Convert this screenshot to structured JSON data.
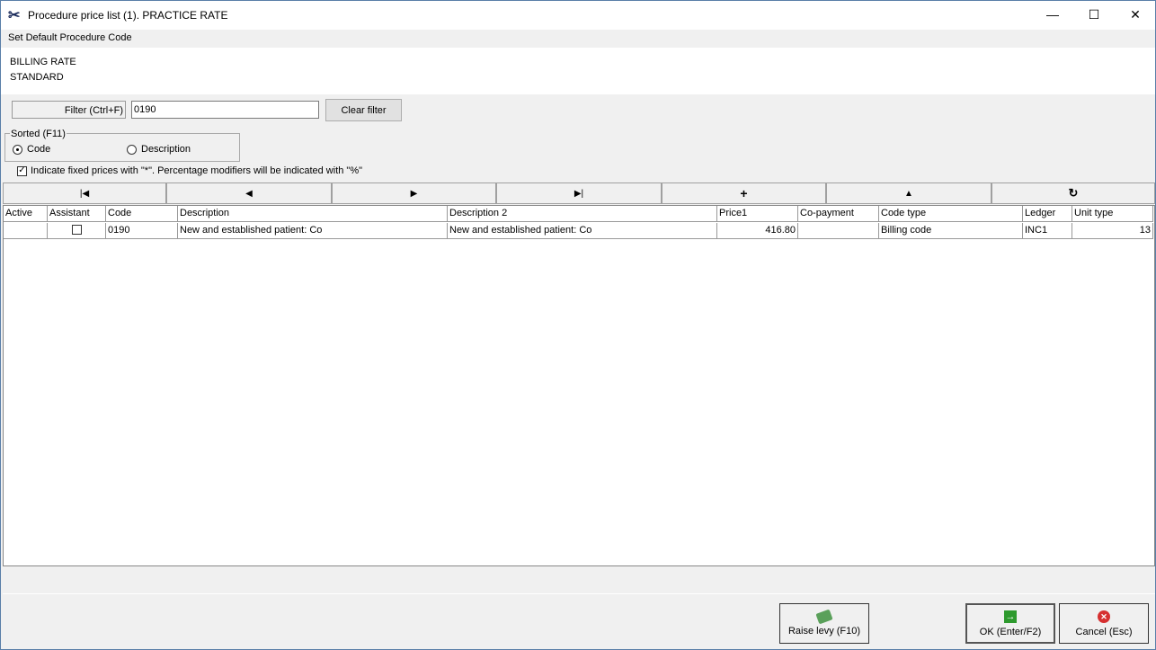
{
  "window": {
    "title": "Procedure price list (1). PRACTICE RATE",
    "app_icon": "tools-icon"
  },
  "menu": {
    "item": "Set Default Procedure Code"
  },
  "info": {
    "line1": "BILLING RATE",
    "line2": "STANDARD"
  },
  "filter": {
    "label": "Filter (Ctrl+F)",
    "value": "0190",
    "clear_label": "Clear filter"
  },
  "sorted": {
    "legend": "Sorted (F11)",
    "options": [
      "Code",
      "Description"
    ],
    "selected": "Code"
  },
  "indicate": {
    "label": "Indicate fixed prices with \"*\". Percentage modifiers will be indicated with \"%\"",
    "checked": true
  },
  "nav": [
    "first",
    "prior",
    "next",
    "last",
    "insert",
    "post",
    "refresh"
  ],
  "grid": {
    "columns": [
      "Active",
      "Assistant",
      "Code",
      "Description",
      "Description 2",
      "Price1",
      "Co-payment",
      "Code type",
      "Ledger",
      "Unit type"
    ],
    "rows": [
      {
        "active": "",
        "assistant": false,
        "code": "0190",
        "description": "New and established patient: Co",
        "description2": "New and established patient: Co",
        "price1": "416.80",
        "copayment": "",
        "code_type": "Billing code",
        "ledger": "INC1",
        "unit_type": "13"
      }
    ]
  },
  "buttons": {
    "raise_levy": "Raise levy (F10)",
    "ok": "OK (Enter/F2)",
    "cancel": "Cancel (Esc)"
  }
}
